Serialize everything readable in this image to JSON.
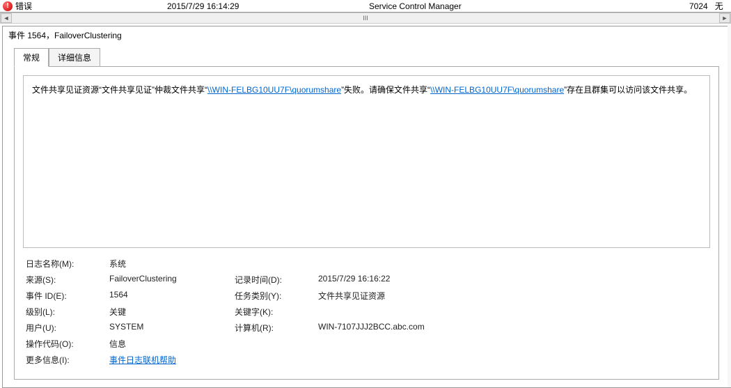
{
  "top_row": {
    "level": "错误",
    "date": "2015/7/29 16:14:29",
    "source": "Service Control Manager",
    "event_id": "7024",
    "task": "无"
  },
  "scroll_marker": "III",
  "scroll_left": "◄",
  "scroll_right": "►",
  "panel_title": "事件 1564，FailoverClustering",
  "tabs": {
    "general": "常规",
    "details": "详细信息"
  },
  "description": {
    "pre1": "文件共享见证资源“文件共享见证”仲裁文件共享“",
    "link1": "\\\\WIN-FELBG10UU7F\\quorumshare",
    "mid1": "”失败。请确保文件共享“",
    "link2": "\\\\WIN-FELBG10UU7F\\quorumshare",
    "post1": "”存在且群集可以访问该文件共享。"
  },
  "details": {
    "log_name_label": "日志名称(M):",
    "log_name_value": "系统",
    "source_label": "来源(S):",
    "source_value": "FailoverClustering",
    "logged_label": "记录时间(D):",
    "logged_value": "2015/7/29 16:16:22",
    "eventid_label": "事件 ID(E):",
    "eventid_value": "1564",
    "task_label": "任务类别(Y):",
    "task_value": "文件共享见证资源",
    "level_label": "级别(L):",
    "level_value": "关键",
    "keywords_label": "关键字(K):",
    "keywords_value": "",
    "user_label": "用户(U):",
    "user_value": "SYSTEM",
    "computer_label": "计算机(R):",
    "computer_value": "WIN-7107JJJ2BCC.abc.com",
    "opcode_label": "操作代码(O):",
    "opcode_value": "信息",
    "moreinfo_label": "更多信息(I):",
    "moreinfo_link": "事件日志联机帮助"
  }
}
